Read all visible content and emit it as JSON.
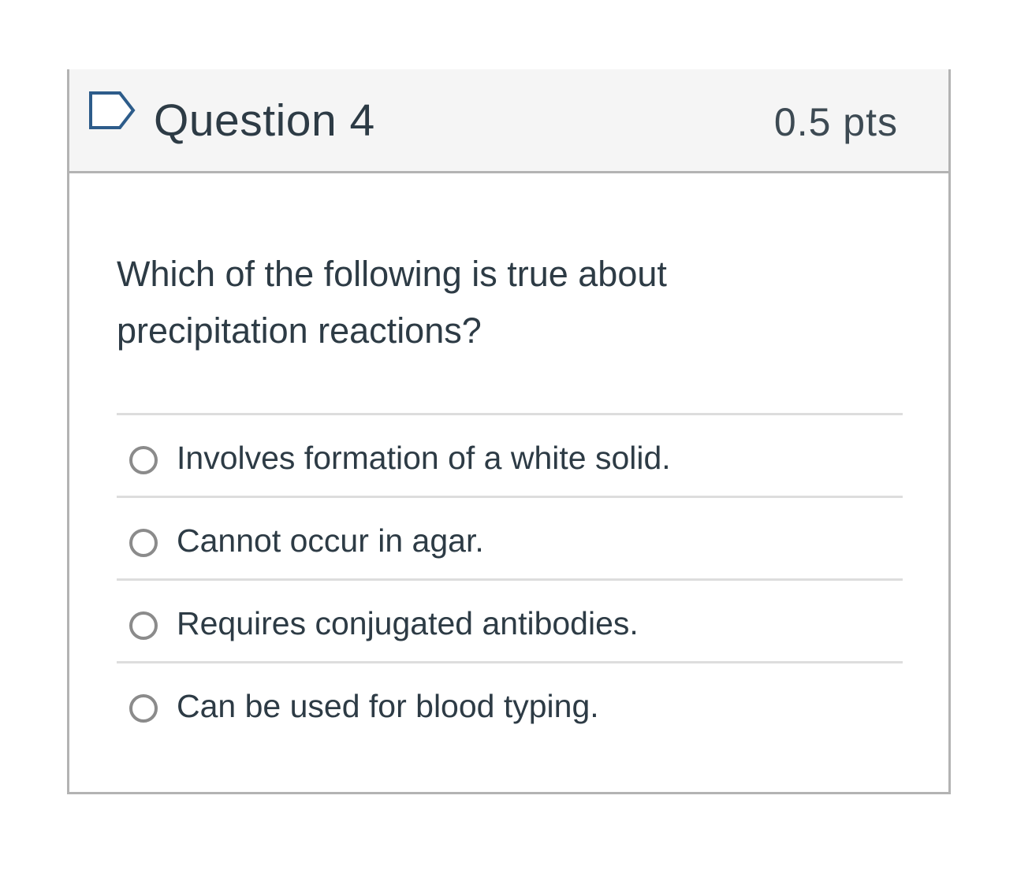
{
  "question": {
    "title": "Question 4",
    "points": "0.5 pts",
    "flag_icon": "flag-bookmark-icon",
    "text_line1": "Which of the following is true about",
    "text_line2": "precipitation reactions?"
  },
  "answers": [
    {
      "label": "Involves formation of a white solid.",
      "selected": false
    },
    {
      "label": "Cannot occur in agar.",
      "selected": false
    },
    {
      "label": "Requires conjugated antibodies.",
      "selected": false
    },
    {
      "label": "Can be used for blood typing.",
      "selected": false
    }
  ],
  "colors": {
    "header_bg": "#f5f5f5",
    "border": "#b3b3b3",
    "text": "#2d3b45",
    "flag_stroke": "#2d5c8a",
    "radio_border": "#8b8b8b",
    "divider": "#dddddd"
  }
}
